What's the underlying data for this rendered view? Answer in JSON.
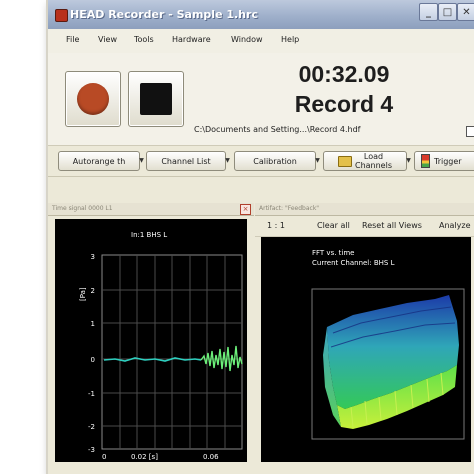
{
  "window": {
    "title": "HEAD Recorder - Sample 1.hrc",
    "buttons": {
      "minimize": "_",
      "maximize": "□",
      "close": "✕"
    }
  },
  "menu": [
    "File",
    "View",
    "Tools",
    "Hardware",
    "Window",
    "Help"
  ],
  "transport": {
    "time": "00:32.09",
    "record": "Record 4",
    "path": "C:\\Documents and Setting...\\Record 4.hdf"
  },
  "toolbar": {
    "autorange": "Autorange th",
    "channel_list": "Channel List",
    "calibration": "Calibration",
    "load_channels_line1": "Load",
    "load_channels_line2": "Channels",
    "trigger": "Trigger"
  },
  "scope_panel": {
    "title": "Time signal 0000 L1",
    "channel": "In:1 BHS L",
    "y_unit": "[Pa]",
    "y_ticks": [
      "3",
      "2",
      "1",
      "0",
      "-1",
      "-2",
      "-3"
    ],
    "x_ticks": [
      "0",
      "0.02 [s]",
      "0.06"
    ]
  },
  "fft_panel": {
    "title": "Artifact: \"Feedback\"",
    "toolbar": {
      "zoom": "1 : 1",
      "clear_all": "Clear all",
      "reset_views": "Reset all Views",
      "analyze": "Analyze"
    },
    "label_line1": "FFT vs. time",
    "label_line2": "Current Channel: BHS L"
  },
  "colors": {
    "trace": "#2fd0c0",
    "trace_burst": "#6cf07a",
    "grid": "#5a5a5a",
    "record_button": "#b84a25"
  }
}
